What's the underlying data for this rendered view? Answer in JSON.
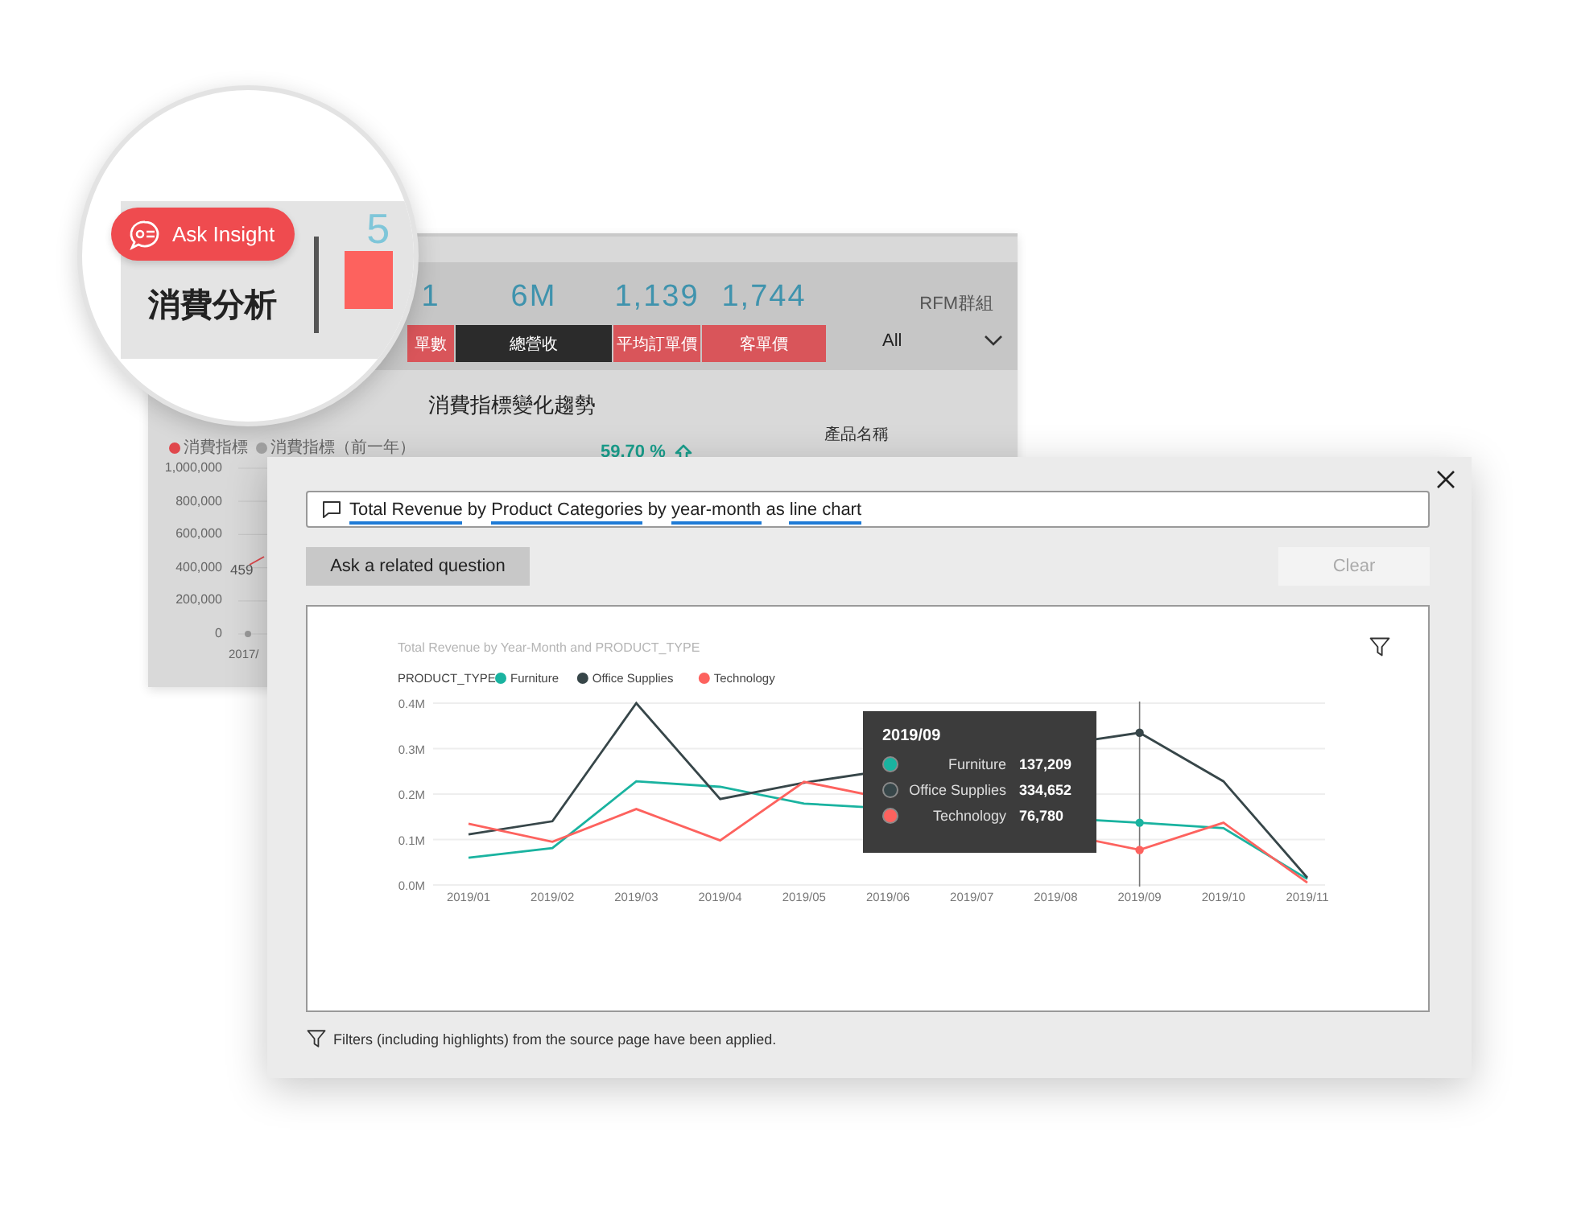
{
  "dashboard": {
    "kpis": [
      {
        "value": "1",
        "label": "單數",
        "selected": false
      },
      {
        "value": "6M",
        "label": "總營收",
        "selected": true
      },
      {
        "value": "1,139",
        "label": "平均訂單價",
        "selected": false
      },
      {
        "value": "1,744",
        "label": "客單價",
        "selected": false
      }
    ],
    "filter": {
      "label": "RFM群組",
      "value": "All"
    },
    "trend": {
      "title": "消費指標變化趨勢",
      "legend": [
        {
          "label": "消費指標",
          "color": "#e0474c"
        },
        {
          "label": "消費指標（前一年）",
          "color": "#a3a3a3"
        }
      ],
      "change": "59.70 %",
      "y_labels": [
        "1,000,000",
        "800,000",
        "600,000",
        "400,000",
        "200,000",
        "0"
      ],
      "point_label": "459",
      "x_label": "2017/"
    },
    "product_header": "產品名稱"
  },
  "magnifier": {
    "button": "Ask Insight",
    "title": "消費分析",
    "kpi_fragment": "5"
  },
  "dialog": {
    "query": [
      {
        "text": "Total Revenue",
        "term": true
      },
      {
        "text": "by",
        "term": false
      },
      {
        "text": "Product Categories",
        "term": true
      },
      {
        "text": "by",
        "term": false
      },
      {
        "text": "year-month",
        "term": true
      },
      {
        "text": "as",
        "term": false
      },
      {
        "text": "line chart",
        "term": true
      }
    ],
    "buttons": [
      {
        "label": "Ask a related question",
        "disabled": false
      },
      {
        "label": "Clear",
        "disabled": true
      }
    ],
    "chart_data": {
      "type": "line",
      "title": "Total Revenue by Year-Month and PRODUCT_TYPE",
      "legend_title": "PRODUCT_TYPE",
      "categories": [
        "2019/01",
        "2019/02",
        "2019/03",
        "2019/04",
        "2019/05",
        "2019/06",
        "2019/07",
        "2019/08",
        "2019/09",
        "2019/10",
        "2019/11"
      ],
      "grid": true,
      "legend": "top-left",
      "ref_lines": [
        {
          "axis": "x",
          "value": "2019/09",
          "color": "#777777"
        }
      ],
      "series": [
        {
          "name": "Furniture",
          "color": "#1ab3a0",
          "values": [
            0.06,
            0.081,
            0.228,
            0.216,
            0.179,
            null,
            null,
            null,
            0.137,
            0.125,
            0.013
          ]
        },
        {
          "name": "Office Supplies",
          "color": "#374649",
          "values": [
            0.111,
            0.14,
            0.4,
            0.189,
            0.225,
            null,
            null,
            null,
            0.335,
            0.228,
            0.016
          ]
        },
        {
          "name": "Technology",
          "color": "#fd625e",
          "values": [
            0.135,
            0.095,
            0.167,
            0.098,
            0.227,
            null,
            null,
            null,
            0.077,
            0.137,
            0.005
          ]
        }
      ],
      "ylim": [
        0,
        0.4
      ],
      "yticks": [
        {
          "value": 0,
          "label": "0.0M"
        },
        {
          "value": 0.1,
          "label": "0.1M"
        },
        {
          "value": 0.2,
          "label": "0.2M"
        },
        {
          "value": 0.3,
          "label": "0.3M"
        },
        {
          "value": 0.4,
          "label": "0.4M"
        }
      ]
    },
    "tooltip": {
      "title": "2019/09",
      "rows": [
        {
          "name": "Furniture",
          "value": "137,209",
          "color": "#1ab3a0"
        },
        {
          "name": "Office Supplies",
          "value": "334,652",
          "color": "#374649"
        },
        {
          "name": "Technology",
          "value": "76,780",
          "color": "#fd625e"
        }
      ]
    },
    "footer": "Filters (including highlights) from the source page have been applied."
  }
}
